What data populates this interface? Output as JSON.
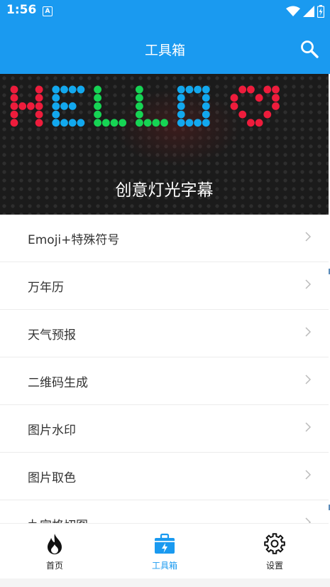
{
  "status": {
    "time": "1:56",
    "notification_badge": "A"
  },
  "header": {
    "title": "工具箱"
  },
  "banner": {
    "led_text": "HELLO ♡",
    "caption": "创意灯光字幕"
  },
  "list": {
    "items": [
      {
        "label": "Emoji+特殊符号"
      },
      {
        "label": "万年历"
      },
      {
        "label": "天气预报"
      },
      {
        "label": "二维码生成"
      },
      {
        "label": "图片水印"
      },
      {
        "label": "图片取色"
      },
      {
        "label": "九宫格切图"
      }
    ]
  },
  "tabs": [
    {
      "label": "首页",
      "icon": "fire-icon",
      "active": false
    },
    {
      "label": "工具箱",
      "icon": "toolbox-icon",
      "active": true
    },
    {
      "label": "设置",
      "icon": "gear-icon",
      "active": false
    }
  ],
  "colors": {
    "primary": "#1a9af0",
    "led_red": "#ee1c3c",
    "led_blue": "#12a8ee",
    "led_green": "#16d454"
  }
}
